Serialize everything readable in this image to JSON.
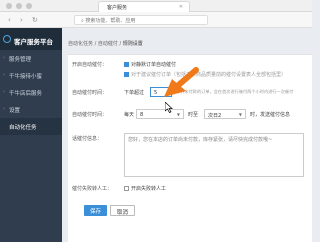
{
  "browser": {
    "tab_title": "客户服务",
    "url": "搜索功能、帮助、应用"
  },
  "sidebar": {
    "brand": "客户服务平台",
    "items": [
      {
        "label": "服务管理",
        "caret": "›"
      },
      {
        "label": "千牛接待小蜜",
        "caret": "›"
      },
      {
        "label": "千牛店后服务",
        "caret": "›"
      },
      {
        "label": "设置",
        "caret": "›"
      },
      {
        "label": "自动化任务",
        "caret": ""
      }
    ]
  },
  "breadcrumb": [
    "自动化任务",
    "自动催付",
    "规则设置"
  ],
  "form": {
    "enable_label": "开启自动催付：",
    "enable_checkbox_label": "对静默订单自动催付",
    "suggest_text": "对于建议催付订单（包括下单商品质量前的催付设置表人全部包括里）",
    "time_label": "自动催付时间：",
    "time_prefix": "下单超过",
    "time_value": "5",
    "time_suffix": "分钟未付款的订单，会在首次进行催付两个小时内进行一次催付",
    "range_label": "自动催付时间：",
    "range_prefix": "每天",
    "range_start": "8",
    "range_mid": "时至",
    "range_end": "次日2",
    "range_suffix": "时，发送催付信息",
    "msg_label": "话催付信息：",
    "msg_placeholder": "您好，您在本店的订单尚未付款，库存紧张，请尽快完成付款哦~",
    "manual_label": "催付失败转人工：",
    "manual_checkbox_label": "开启失败转人工",
    "save": "保存",
    "cancel": "取消"
  }
}
